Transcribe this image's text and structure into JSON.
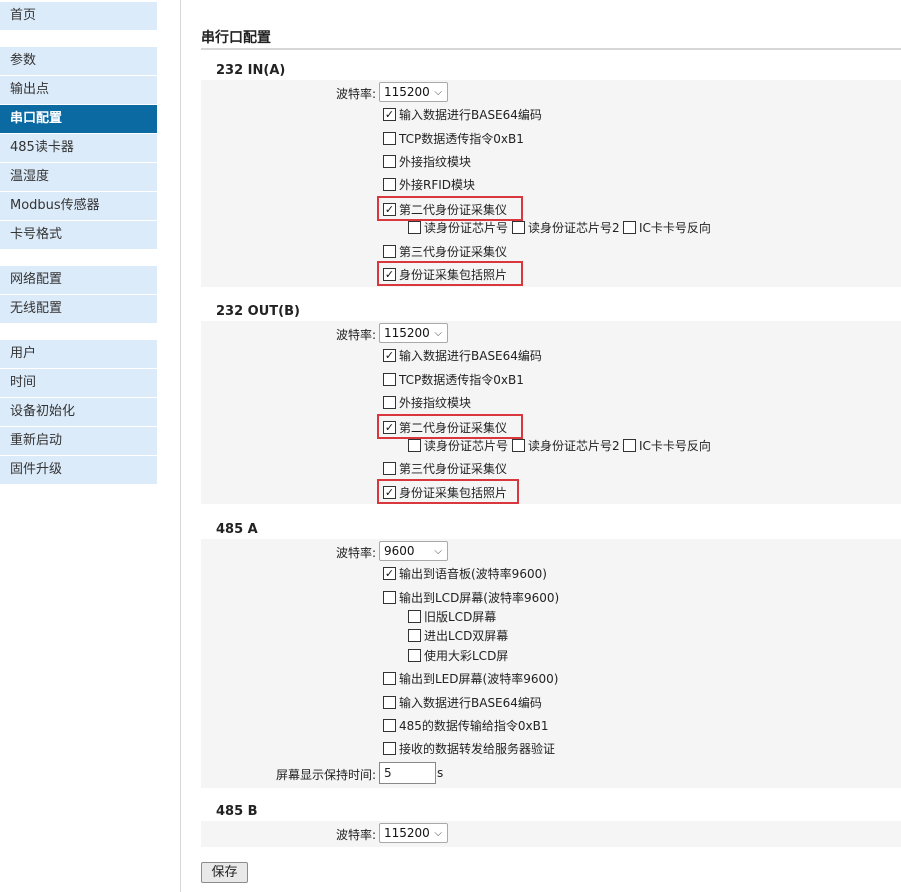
{
  "sidebar": {
    "group1": [
      {
        "label": "首页"
      }
    ],
    "group2": [
      {
        "label": "参数"
      },
      {
        "label": "输出点"
      },
      {
        "label": "串口配置"
      },
      {
        "label": "485读卡器"
      },
      {
        "label": "温湿度"
      },
      {
        "label": "Modbus传感器"
      },
      {
        "label": "卡号格式"
      }
    ],
    "group3": [
      {
        "label": "网络配置"
      },
      {
        "label": "无线配置"
      }
    ],
    "group4": [
      {
        "label": "用户"
      },
      {
        "label": "时间"
      },
      {
        "label": "设备初始化"
      },
      {
        "label": "重新启动"
      },
      {
        "label": "固件升级"
      }
    ],
    "active": "串口配置"
  },
  "page": {
    "title": "串行口配置",
    "save_label": "保存"
  },
  "common": {
    "baud_label": "波特率:"
  },
  "in232": {
    "title": "232 IN(A)",
    "baud": "115200",
    "base64": {
      "label": "输入数据进行BASE64编码",
      "checked": true
    },
    "tcp": {
      "label": "TCP数据透传指令0xB1",
      "checked": false
    },
    "fp": {
      "label": "外接指纹模块",
      "checked": false
    },
    "rfid": {
      "label": "外接RFID模块",
      "checked": false
    },
    "id2": {
      "label": "第二代身份证采集仪",
      "checked": true
    },
    "chip": {
      "label": "读身份证芯片号",
      "checked": false
    },
    "chip2": {
      "label": "读身份证芯片号2",
      "checked": false
    },
    "icrev": {
      "label": "IC卡卡号反向",
      "checked": false
    },
    "id3": {
      "label": "第三代身份证采集仪",
      "checked": false
    },
    "photo": {
      "label": "身份证采集包括照片",
      "checked": true
    }
  },
  "out232": {
    "title": "232 OUT(B)",
    "baud": "115200",
    "base64": {
      "label": "输入数据进行BASE64编码",
      "checked": true
    },
    "tcp": {
      "label": "TCP数据透传指令0xB1",
      "checked": false
    },
    "fp": {
      "label": "外接指纹模块",
      "checked": false
    },
    "id2": {
      "label": "第二代身份证采集仪",
      "checked": true
    },
    "chip": {
      "label": "读身份证芯片号",
      "checked": false
    },
    "chip2": {
      "label": "读身份证芯片号2",
      "checked": false
    },
    "icrev": {
      "label": "IC卡卡号反向",
      "checked": false
    },
    "id3": {
      "label": "第三代身份证采集仪",
      "checked": false
    },
    "photo": {
      "label": "身份证采集包括照片",
      "checked": true
    }
  },
  "a485": {
    "title": "485 A",
    "baud": "9600",
    "voice": {
      "label": "输出到语音板(波特率9600)",
      "checked": true
    },
    "lcd": {
      "label": "输出到LCD屏幕(波特率9600)",
      "checked": false
    },
    "oldlcd": {
      "label": "旧版LCD屏幕",
      "checked": false
    },
    "duallcd": {
      "label": "进出LCD双屏幕",
      "checked": false
    },
    "colorlcd": {
      "label": "使用大彩LCD屏",
      "checked": false
    },
    "led": {
      "label": "输出到LED屏幕(波特率9600)",
      "checked": false
    },
    "base64": {
      "label": "输入数据进行BASE64编码",
      "checked": false
    },
    "cmd": {
      "label": "485的数据传输给指令0xB1",
      "checked": false
    },
    "fwd": {
      "label": "接收的数据转发给服务器验证",
      "checked": false
    },
    "hold_label": "屏幕显示保持时间:",
    "hold_value": "5",
    "hold_unit": "s"
  },
  "b485": {
    "title": "485 B",
    "baud": "115200"
  }
}
